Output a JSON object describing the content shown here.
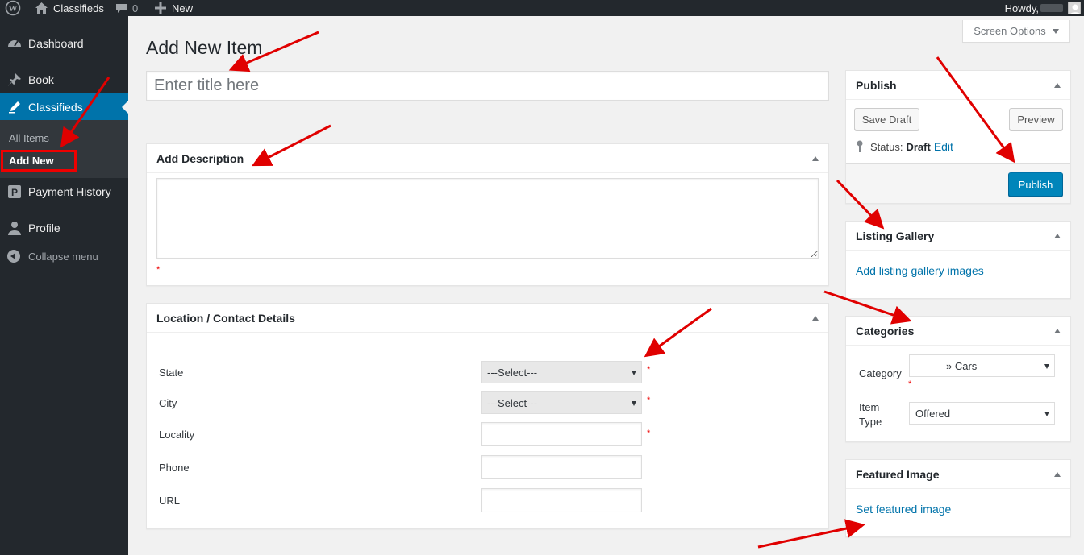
{
  "adminbar": {
    "site_name": "Classifieds",
    "comments_count": "0",
    "new_label": "New",
    "howdy_label": "Howdy,"
  },
  "sidebar": {
    "items": [
      {
        "label": "Dashboard",
        "icon": "dashboard-icon"
      },
      {
        "label": "Book",
        "icon": "pin-icon"
      },
      {
        "label": "Classifieds",
        "icon": "edit-icon"
      },
      {
        "label": "Payment History",
        "icon": "paypal-icon"
      },
      {
        "label": "Profile",
        "icon": "user-icon"
      }
    ],
    "submenu": [
      "All Items",
      "Add New"
    ],
    "collapse_label": "Collapse menu"
  },
  "screen_options_label": "Screen Options",
  "page_title": "Add New Item",
  "title_placeholder": "Enter title here",
  "description_box": {
    "title": "Add Description",
    "required_mark": "*"
  },
  "location_box": {
    "title": "Location / Contact Details",
    "fields": [
      {
        "label": "State",
        "type": "select",
        "value": "---Select---",
        "required": "*"
      },
      {
        "label": "City",
        "type": "select",
        "value": "---Select---",
        "required": "*"
      },
      {
        "label": "Locality",
        "type": "text",
        "value": "",
        "required": "*"
      },
      {
        "label": "Phone",
        "type": "text",
        "value": ""
      },
      {
        "label": "URL",
        "type": "text",
        "value": ""
      }
    ]
  },
  "publish_box": {
    "title": "Publish",
    "save_draft": "Save Draft",
    "preview": "Preview",
    "status_label": "Status:",
    "status_value": "Draft",
    "edit_link": "Edit",
    "publish_button": "Publish"
  },
  "gallery_box": {
    "title": "Listing Gallery",
    "link": "Add listing gallery images"
  },
  "categories_box": {
    "title": "Categories",
    "category_label": "Category",
    "category_value": "» Cars",
    "required_mark": "*",
    "item_type_label": "Item Type",
    "item_type_value": "Offered"
  },
  "featured_box": {
    "title": "Featured Image",
    "link": "Set featured image"
  },
  "colors": {
    "admin_dark": "#23282d",
    "admin_blue": "#0073aa",
    "annotation_red": "#e00000"
  }
}
